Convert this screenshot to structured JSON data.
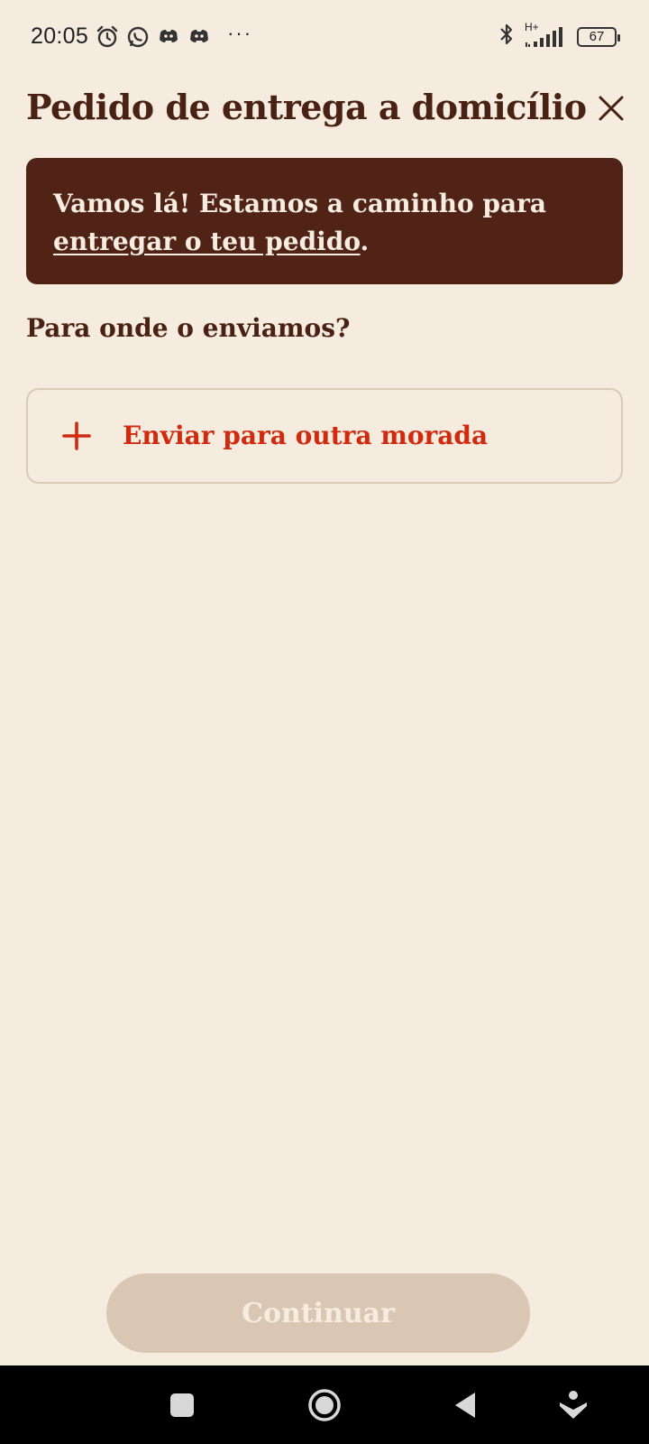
{
  "status_bar": {
    "time": "20:05",
    "network": "H+",
    "battery": "67",
    "more": "···",
    "icons": [
      "alarm-icon",
      "whatsapp-icon",
      "discord-icon",
      "discord-icon",
      "bluetooth-icon",
      "signal-icon",
      "battery-icon"
    ]
  },
  "header": {
    "title": "Pedido de entrega a domicílio",
    "close_icon": "close-icon"
  },
  "banner": {
    "text_line1": "Vamos lá! Estamos a caminho para",
    "link_text": "entregar o teu pedido",
    "suffix": "."
  },
  "section": {
    "title": "Para onde o enviamos?"
  },
  "address_option": {
    "label": "Enviar para outra morada",
    "icon": "plus-icon"
  },
  "footer": {
    "continue_label": "Continuar"
  },
  "nav": {
    "items": [
      "recents-icon",
      "home-icon",
      "back-icon",
      "assistant-icon"
    ]
  },
  "colors": {
    "background": "#f5ebde",
    "brand_dark": "#512316",
    "accent_red": "#d12b0f",
    "disabled_button": "#d9c7b3"
  }
}
